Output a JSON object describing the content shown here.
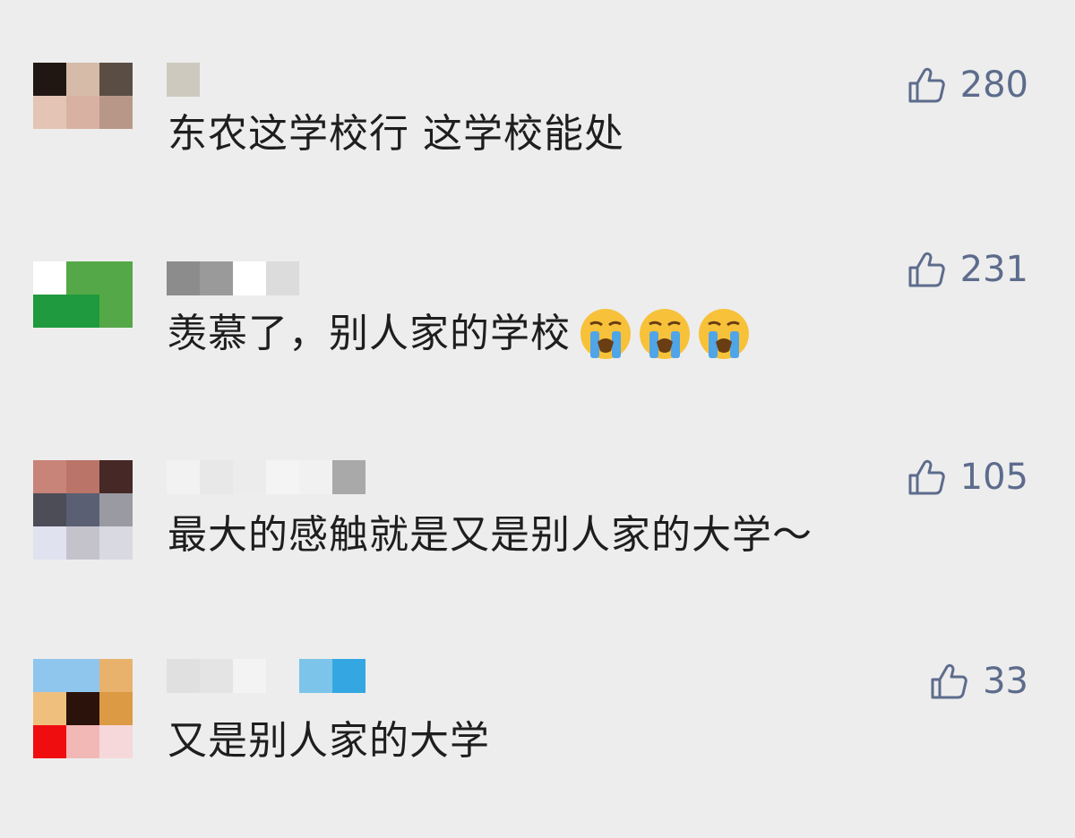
{
  "comments": [
    {
      "text": "东农这学校行 这学校能处",
      "likes": "280",
      "like_icon": "thumbs-up-outline-icon",
      "avatar_colors": [
        "#201713",
        "#d6bba8",
        "#5a4d44",
        "#e4c4b4",
        "#d9b1a2",
        "#b99788"
      ],
      "nick_colors": [
        "#cdc9bf"
      ],
      "emoji_count": 0
    },
    {
      "text": "羡慕了，别人家的学校",
      "likes": "231",
      "like_icon": "thumbs-up-outline-icon",
      "avatar_colors": [
        "#ffffff",
        "#55a847",
        "#55a847",
        "#1f9a3e",
        "#1f9a3e",
        "#55a847"
      ],
      "nick_colors": [
        "#8c8c8c",
        "#9a9a9a",
        "#ffffff",
        "#dcdcdc"
      ],
      "emoji": "loudly-crying-face-emoji",
      "emoji_count": 3
    },
    {
      "text": "最大的感触就是又是别人家的大学～",
      "likes": "105",
      "like_icon": "thumbs-up-outline-icon",
      "avatar_colors": [
        "#c88479",
        "#ba7468",
        "#462826",
        "#4d4d57",
        "#5a5f73",
        "#9a9aa3",
        "#e1e2ef",
        "#c4c3cc",
        "#d9d9e1"
      ],
      "nick_colors": [
        "#f2f2f2",
        "#e8e8e8",
        "#ececec",
        "#f4f4f4",
        "#f1f1f1",
        "#a9a9a9"
      ],
      "emoji_count": 0
    },
    {
      "text": "又是别人家的大学",
      "likes": "33",
      "like_icon": "thumbs-up-outline-icon",
      "avatar_colors": [
        "#8fc6ee",
        "#8fc6ee",
        "#e8b26d",
        "#efc07d",
        "#2b120b",
        "#dc9a45",
        "#f00d10",
        "#f2b8b6",
        "#f6d8da"
      ],
      "nick_colors": [
        "#e0e0e0",
        "#e4e4e4",
        "#f3f3f3",
        "#ededed",
        "#7cc4ea",
        "#34a7e2"
      ],
      "emoji_count": 0
    }
  ]
}
